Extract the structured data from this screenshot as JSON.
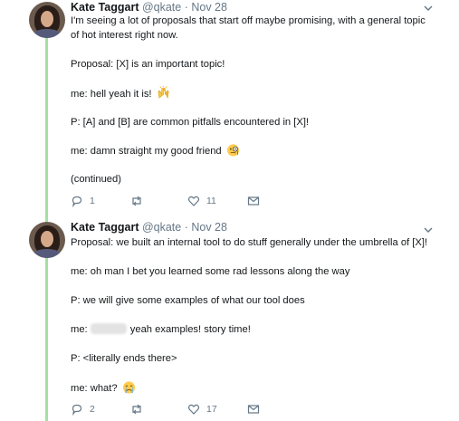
{
  "tweets": [
    {
      "author": "Kate Taggart",
      "handle": "@qkate",
      "sep": " · ",
      "date": "Nov 28",
      "lines": [
        "I'm seeing a lot of proposals that start off maybe promising, with a general topic",
        "of hot interest right now.",
        "Proposal: [X] is an important topic!",
        "me: hell yeah it is!",
        "P: [A] and [B] are common pitfalls encountered in [X]!",
        "me: damn straight my good friend",
        "(continued)"
      ],
      "replies": "1",
      "retweets": "",
      "likes": "11",
      "emojis": [
        "raised-hands-emoji",
        "monocle-face-emoji"
      ]
    },
    {
      "author": "Kate Taggart",
      "handle": "@qkate",
      "sep": " · ",
      "date": "Nov 28",
      "lines": [
        "Proposal: we built an internal tool to do stuff generally under the umbrella of [X]!",
        "me: oh man I bet you learned some rad lessons along the way",
        "P: we will give some examples of what our tool does",
        "me:",
        "yeah examples! story time!",
        "P: <literally ends there>",
        "me: what?"
      ],
      "replies": "2",
      "retweets": "",
      "likes": "17",
      "emojis": [
        "crying-face-emoji"
      ]
    }
  ],
  "colors": {
    "thread_line": "#a5dfa3",
    "meta": "#657786",
    "text": "#14171a"
  }
}
